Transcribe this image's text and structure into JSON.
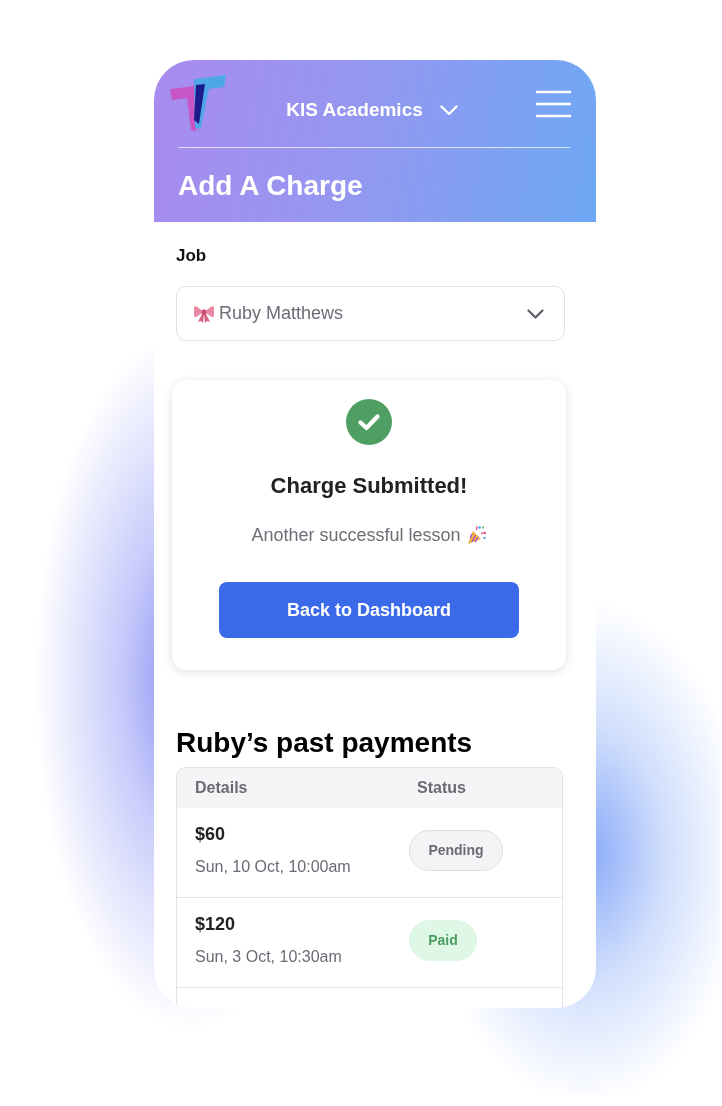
{
  "header": {
    "brand": "KIS Academics",
    "title": "Add A Charge"
  },
  "job": {
    "label": "Job",
    "value": "Ruby Matthews"
  },
  "confirmation": {
    "title": "Charge Submitted!",
    "message": "Another successful lesson",
    "button": "Back to Dashboard"
  },
  "payments": {
    "title": "Ruby’s past payments",
    "columns": [
      "Details",
      "Status"
    ],
    "rows": [
      {
        "amount": "$60",
        "date": "Sun, 10 Oct, 10:00am",
        "status": "Pending",
        "kind": "pending"
      },
      {
        "amount": "$120",
        "date": "Sun, 3 Oct, 10:30am",
        "status": "Paid",
        "kind": "paid"
      }
    ]
  }
}
